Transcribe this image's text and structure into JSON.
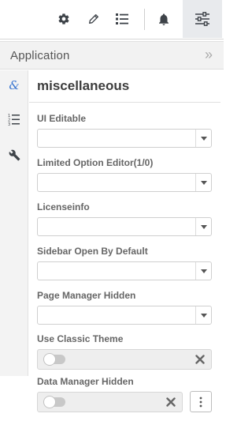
{
  "header": {
    "icons": [
      "gear-icon",
      "pencil-icon",
      "list-icon",
      "bell-icon",
      "sliders-icon"
    ]
  },
  "panel": {
    "title": "Application",
    "collapse_glyph": "»"
  },
  "sidetabs": {
    "items": [
      {
        "icon": "ampersand-icon",
        "glyph": "&",
        "active": true
      },
      {
        "icon": "numbered-list-icon",
        "active": false
      },
      {
        "icon": "wrench-icon",
        "active": false
      }
    ]
  },
  "section": {
    "title": "miscellaneous"
  },
  "fields": [
    {
      "label": "UI Editable",
      "type": "select",
      "value": ""
    },
    {
      "label": "Limited Option Editor(1/0)",
      "type": "select",
      "value": ""
    },
    {
      "label": "Licenseinfo",
      "type": "select",
      "value": ""
    },
    {
      "label": "Sidebar Open By Default",
      "type": "select",
      "value": ""
    },
    {
      "label": "Page Manager Hidden",
      "type": "select",
      "value": ""
    },
    {
      "label": "Use Classic Theme",
      "type": "toggle",
      "value": false
    },
    {
      "label": "Data Manager Hidden",
      "type": "toggle",
      "value": false
    }
  ],
  "colors": {
    "accent": "#3a76d1",
    "icon_dark": "#3e4349",
    "header_bg": "#f2f2f2",
    "active_tab_bg": "#e8eaed"
  }
}
